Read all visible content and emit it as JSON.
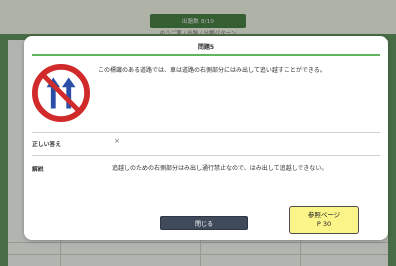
{
  "background": {
    "top_bar_text": "出題数 8/10",
    "subtitle": "ゆうご第 / 出題 / 分類パターン"
  },
  "modal": {
    "title": "問題5",
    "question": "この標識のある道路では、車は道路の右側部分にはみ出して追い越すことができる。",
    "answer_label": "正しい答え",
    "answer_mark": "×",
    "explanation_label": "解説",
    "explanation": "追越しのための右側部分はみ出し通行禁止なので、はみ出して追越しできない。",
    "close_label": "閉じる",
    "reference": {
      "line1": "参照ページ",
      "line2": "P 30"
    }
  },
  "colors": {
    "accent_green": "#64b35e",
    "sign_red": "#d12a2a",
    "sign_blue": "#2b4fa8",
    "button_dark": "#3f4a5a",
    "reference_yellow": "#fbf489"
  },
  "icons": {
    "sign": "no-overtaking-right-side-sign-icon"
  }
}
